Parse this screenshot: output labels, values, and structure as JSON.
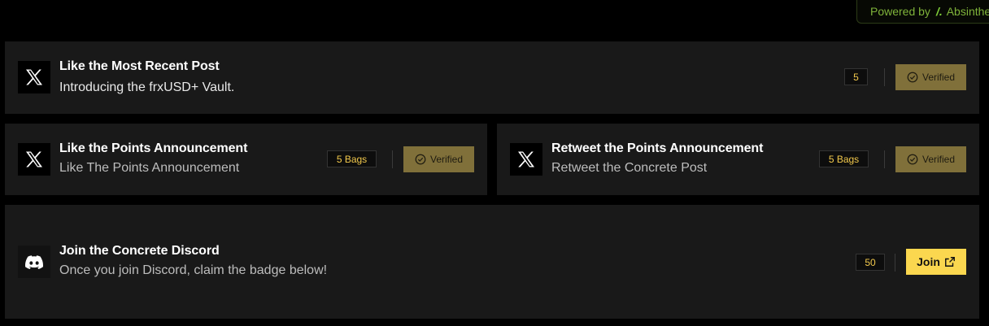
{
  "powered_by": {
    "label": "Powered by",
    "brand_mark": "/.",
    "brand": "Absinthe"
  },
  "tasks": [
    {
      "icon": "x-logo-icon",
      "title": "Like the Most Recent Post",
      "subtitle": "Introducing the frxUSD+ Vault.",
      "reward": "5",
      "status": "Verified"
    },
    {
      "icon": "x-logo-icon",
      "title": "Like the Points Announcement",
      "subtitle": "Like The Points Announcement",
      "reward": "5 Bags",
      "status": "Verified"
    },
    {
      "icon": "x-logo-icon",
      "title": "Retweet the Points Announcement",
      "subtitle": "Retweet the Concrete Post",
      "reward": "5 Bags",
      "status": "Verified"
    },
    {
      "icon": "discord-icon",
      "title": "Join the Concrete Discord",
      "subtitle": "Once you join Discord, claim the badge below!",
      "reward": "50",
      "action": "Join"
    }
  ],
  "colors": {
    "background": "#000000",
    "card": "#191919",
    "verified_button": "#80703a",
    "join_button": "#fbd74f",
    "reward_text": "#f2c94c",
    "brand_green": "#7fb33a"
  }
}
